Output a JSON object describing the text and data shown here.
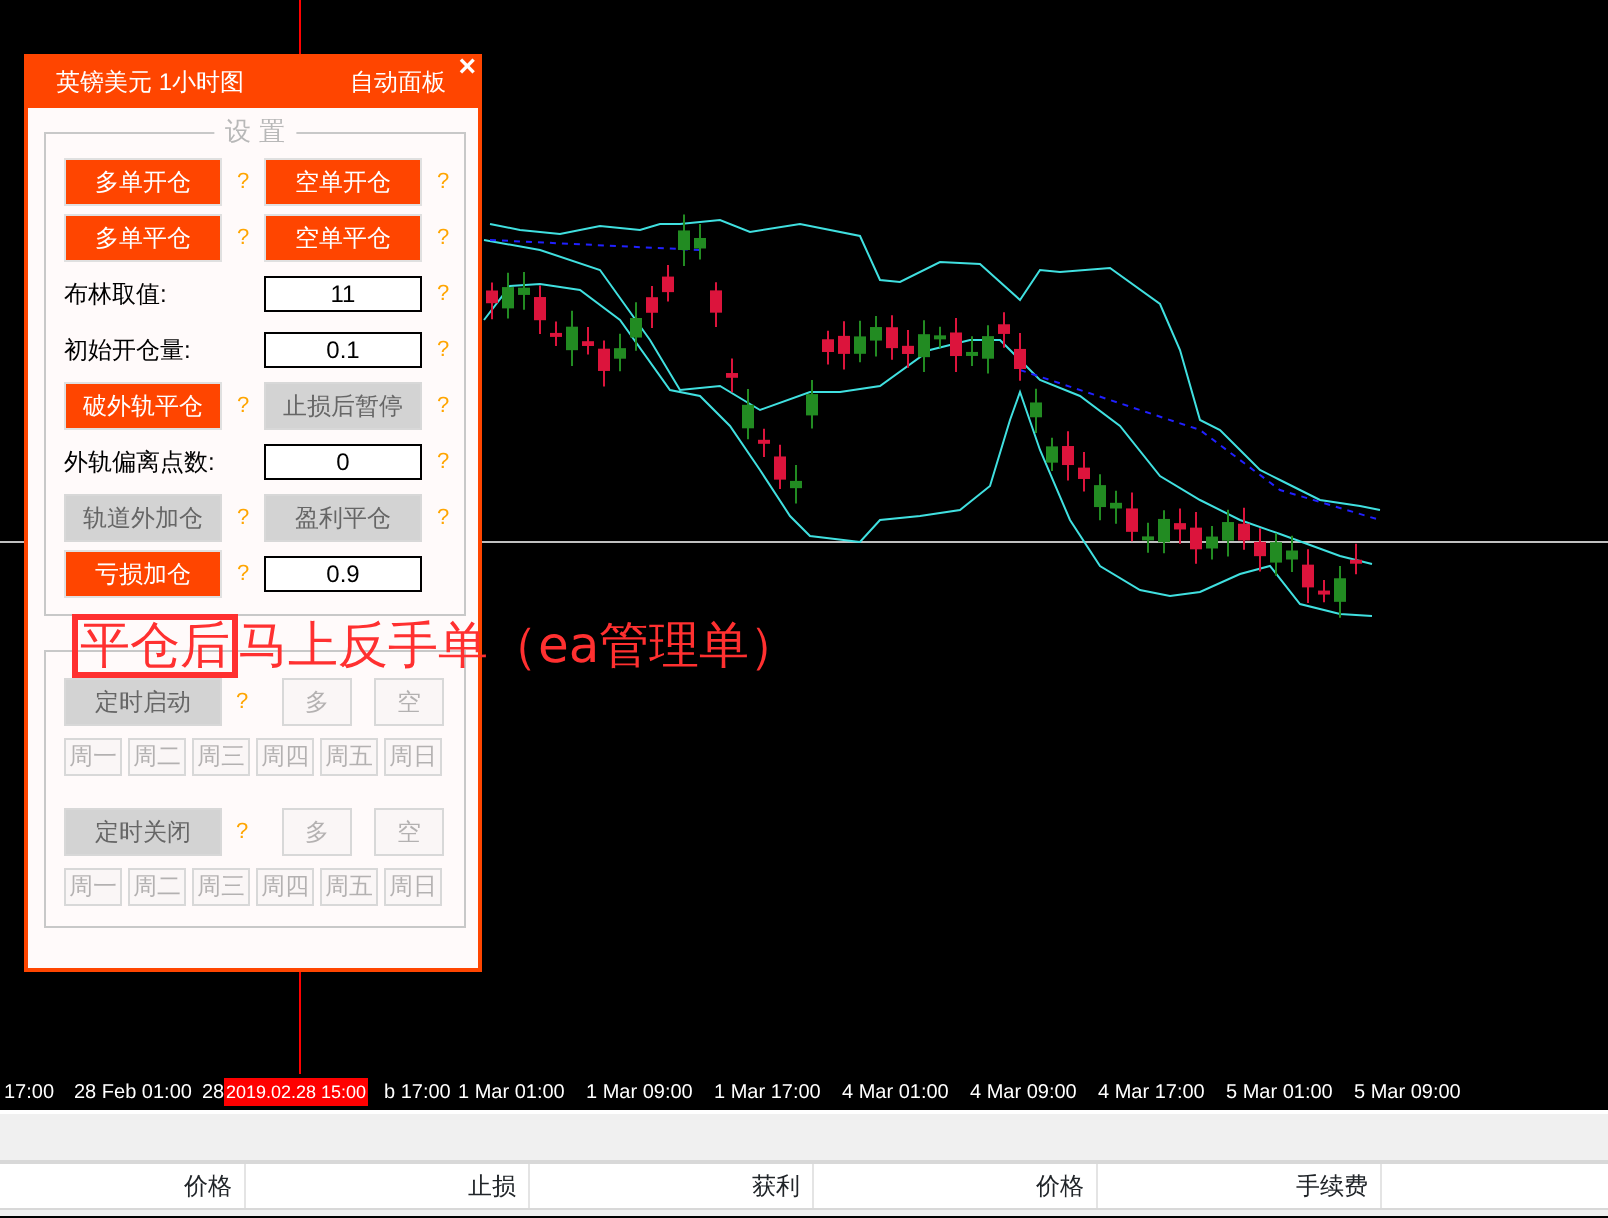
{
  "panel": {
    "title": "英镑美元 1小时图",
    "subtitle": "自动面板",
    "close": "×",
    "settings_group": {
      "title": "设 置",
      "rows": [
        {
          "cells": [
            {
              "kind": "button",
              "label": "多单开仓",
              "enabled": true,
              "help": "?"
            },
            {
              "kind": "button",
              "label": "空单开仓",
              "enabled": true,
              "help": "?"
            }
          ]
        },
        {
          "cells": [
            {
              "kind": "button",
              "label": "多单平仓",
              "enabled": true,
              "help": "?"
            },
            {
              "kind": "button",
              "label": "空单平仓",
              "enabled": true,
              "help": "?"
            }
          ]
        },
        {
          "cells": [
            {
              "kind": "label",
              "label": "布林取值:"
            },
            {
              "kind": "input",
              "value": "11",
              "help": "?"
            }
          ]
        },
        {
          "cells": [
            {
              "kind": "label",
              "label": "初始开仓量:"
            },
            {
              "kind": "input",
              "value": "0.1",
              "help": "?"
            }
          ]
        },
        {
          "cells": [
            {
              "kind": "button",
              "label": "破外轨平仓",
              "enabled": true,
              "help": "?"
            },
            {
              "kind": "button",
              "label": "止损后暂停",
              "enabled": false,
              "help": "?"
            }
          ]
        },
        {
          "cells": [
            {
              "kind": "label",
              "label": "外轨偏离点数:"
            },
            {
              "kind": "input",
              "value": "0",
              "help": "?"
            }
          ]
        },
        {
          "cells": [
            {
              "kind": "button",
              "label": "轨道外加仓",
              "enabled": false,
              "help": "?"
            },
            {
              "kind": "button",
              "label": "盈利平仓",
              "enabled": false,
              "help": "?"
            }
          ]
        },
        {
          "cells": [
            {
              "kind": "button",
              "label": "亏损加仓",
              "enabled": true,
              "help": "?"
            },
            {
              "kind": "input",
              "value": "0.9"
            }
          ]
        }
      ]
    },
    "schedule_group": {
      "sections": [
        {
          "toggle": {
            "label": "定时启动",
            "enabled": false,
            "help": "?"
          },
          "sides": [
            {
              "label": "多",
              "enabled": false
            },
            {
              "label": "空",
              "enabled": false
            }
          ],
          "days": [
            {
              "label": "周一",
              "enabled": false
            },
            {
              "label": "周二",
              "enabled": false
            },
            {
              "label": "周三",
              "enabled": false
            },
            {
              "label": "周四",
              "enabled": false
            },
            {
              "label": "周五",
              "enabled": false
            },
            {
              "label": "周日",
              "enabled": false
            }
          ]
        },
        {
          "toggle": {
            "label": "定时关闭",
            "enabled": false,
            "help": "?"
          },
          "sides": [
            {
              "label": "多",
              "enabled": false
            },
            {
              "label": "空",
              "enabled": false
            }
          ],
          "days": [
            {
              "label": "周一",
              "enabled": false
            },
            {
              "label": "周二",
              "enabled": false
            },
            {
              "label": "周三",
              "enabled": false
            },
            {
              "label": "周四",
              "enabled": false
            },
            {
              "label": "周五",
              "enabled": false
            },
            {
              "label": "周日",
              "enabled": false
            }
          ]
        }
      ]
    }
  },
  "overlay_note": {
    "boxed": "平仓后",
    "rest": "马上反手单（ea管理单）"
  },
  "time_axis": {
    "ticks": [
      "17:00",
      "28 Feb 01:00",
      "28",
      "b 17:00",
      "1 Mar 01:00",
      "1 Mar 09:00",
      "1 Mar 17:00",
      "4 Mar 01:00",
      "4 Mar 09:00",
      "4 Mar 17:00",
      "5 Mar 01:00",
      "5 Mar 09:00"
    ],
    "cursor_label": "2019.02.28 15:00"
  },
  "table": {
    "columns": [
      "价格",
      "止损",
      "获利",
      "价格",
      "手续费"
    ]
  }
}
